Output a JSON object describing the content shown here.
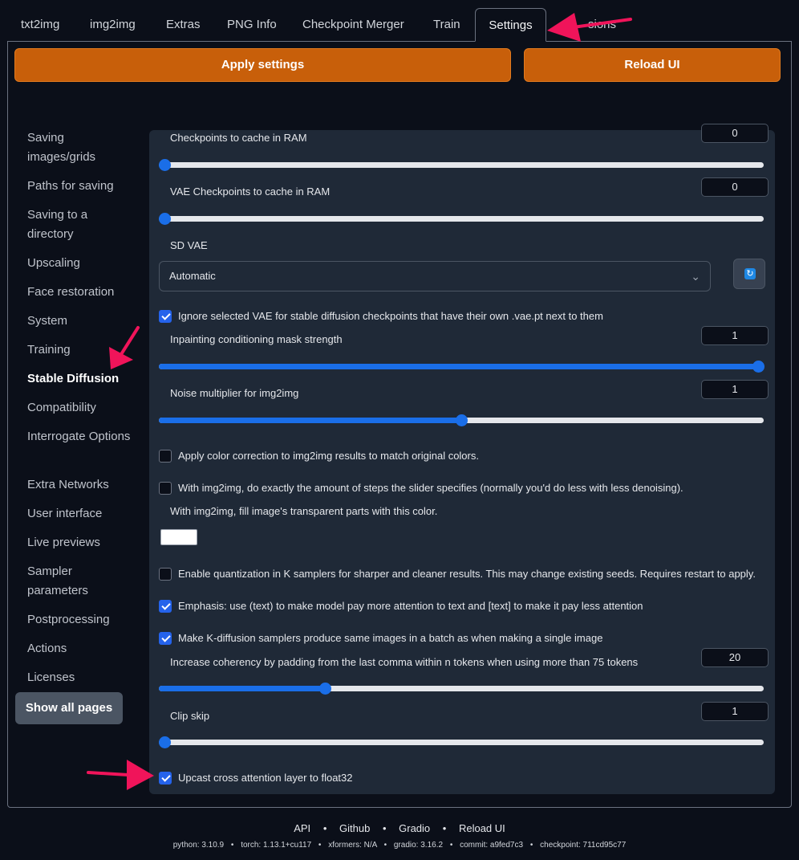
{
  "tabs": [
    {
      "label": "txt2img"
    },
    {
      "label": "img2img"
    },
    {
      "label": "Extras"
    },
    {
      "label": "PNG Info"
    },
    {
      "label": "Checkpoint Merger"
    },
    {
      "label": "Train"
    },
    {
      "label": "Settings",
      "active": true
    },
    {
      "label": "Extensions",
      "partial_visible": "sions"
    }
  ],
  "buttons": {
    "apply": "Apply settings",
    "reload": "Reload UI"
  },
  "sidebar": {
    "items": [
      {
        "label": "Saving images/grids"
      },
      {
        "label": "Paths for saving"
      },
      {
        "label": "Saving to a directory"
      },
      {
        "label": "Upscaling"
      },
      {
        "label": "Face restoration"
      },
      {
        "label": "System"
      },
      {
        "label": "Training"
      },
      {
        "label": "Stable Diffusion",
        "active": true
      },
      {
        "label": "Compatibility"
      },
      {
        "label": "Interrogate Options"
      },
      {
        "label": "Extra Networks"
      },
      {
        "label": "User interface"
      },
      {
        "label": "Live previews"
      },
      {
        "label": "Sampler parameters"
      },
      {
        "label": "Postprocessing"
      },
      {
        "label": "Actions"
      },
      {
        "label": "Licenses"
      }
    ],
    "show_all": "Show all pages"
  },
  "settings": {
    "ckpt_cache": {
      "label": "Checkpoints to cache in RAM",
      "value": "0",
      "fraction": 0
    },
    "vae_cache": {
      "label": "VAE Checkpoints to cache in RAM",
      "value": "0",
      "fraction": 0
    },
    "sd_vae": {
      "label": "SD VAE",
      "value": "Automatic"
    },
    "ignore_vae": {
      "label": "Ignore selected VAE for stable diffusion checkpoints that have their own .vae.pt next to them",
      "checked": true
    },
    "inpaint_mask": {
      "label": "Inpainting conditioning mask strength",
      "value": "1",
      "fraction": 1
    },
    "noise_mult": {
      "label": "Noise multiplier for img2img",
      "value": "1",
      "fraction": 0.5
    },
    "color_correction": {
      "label": "Apply color correction to img2img results to match original colors.",
      "checked": false
    },
    "exact_steps": {
      "label": "With img2img, do exactly the amount of steps the slider specifies (normally you'd do less with less denoising).",
      "checked": false
    },
    "fill_color": {
      "label": "With img2img, fill image's transparent parts with this color.",
      "color": "#ffffff"
    },
    "quantization": {
      "label": "Enable quantization in K samplers for sharper and cleaner results. This may change existing seeds. Requires restart to apply.",
      "checked": false
    },
    "emphasis": {
      "label": "Emphasis: use (text) to make model pay more attention to text and [text] to make it pay less attention",
      "checked": true
    },
    "kdiff_batch": {
      "label": "Make K-diffusion samplers produce same images in a batch as when making a single image",
      "checked": true
    },
    "comma_padding": {
      "label": "Increase coherency by padding from the last comma within n tokens when using more than 75 tokens",
      "value": "20",
      "fraction": 0.275
    },
    "clip_skip": {
      "label": "Clip skip",
      "value": "1",
      "fraction": 0
    },
    "upcast_attn": {
      "label": "Upcast cross attention layer to float32",
      "checked": true
    }
  },
  "footer": {
    "links": [
      "API",
      "Github",
      "Gradio",
      "Reload UI"
    ],
    "separator": "•",
    "info": [
      "python: 3.10.9",
      "torch: 1.13.1+cu117",
      "xformers: N/A",
      "gradio: 3.16.2",
      "commit: a9fed7c3",
      "checkpoint: 711cd95c77"
    ]
  },
  "colors": {
    "accent_orange": "#c85f0a",
    "slider_blue": "#1a6ee8",
    "checkbox_blue": "#2563eb",
    "annotation_arrow": "#f0145a"
  }
}
